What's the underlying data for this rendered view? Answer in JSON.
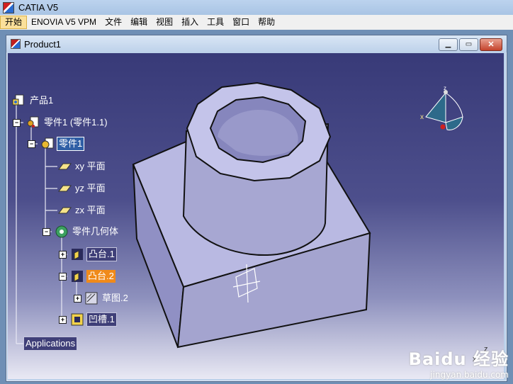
{
  "app": {
    "title": "CATIA V5"
  },
  "menu": [
    {
      "label": "开始",
      "active": true
    },
    {
      "label": "ENOVIA V5 VPM"
    },
    {
      "label": "文件"
    },
    {
      "label": "编辑"
    },
    {
      "label": "视图"
    },
    {
      "label": "插入"
    },
    {
      "label": "工具"
    },
    {
      "label": "窗口"
    },
    {
      "label": "帮助"
    }
  ],
  "document": {
    "title": "Product1"
  },
  "tree": {
    "product": "产品1",
    "part_instance": "零件1 (零件1.1)",
    "part": "零件1",
    "planes": [
      "xy 平面",
      "yz 平面",
      "zx 平面"
    ],
    "body": "零件几何体",
    "pad1": "凸台.1",
    "pad2": "凸台.2",
    "sketch": "草图.2",
    "pocket": "凹槽.1",
    "applications": "Applications"
  },
  "compass": {
    "x_label": "x",
    "z_label": "z"
  },
  "watermark": {
    "brand": "Baidu 经验",
    "url": "jingyan.baidu.com"
  },
  "axis_glyph": {
    "z": "z",
    "x": "x"
  },
  "colors": {
    "model_face": "#a9a9d6",
    "tree_highlight": "#f08a1a",
    "selection": "#2f5ea5"
  }
}
